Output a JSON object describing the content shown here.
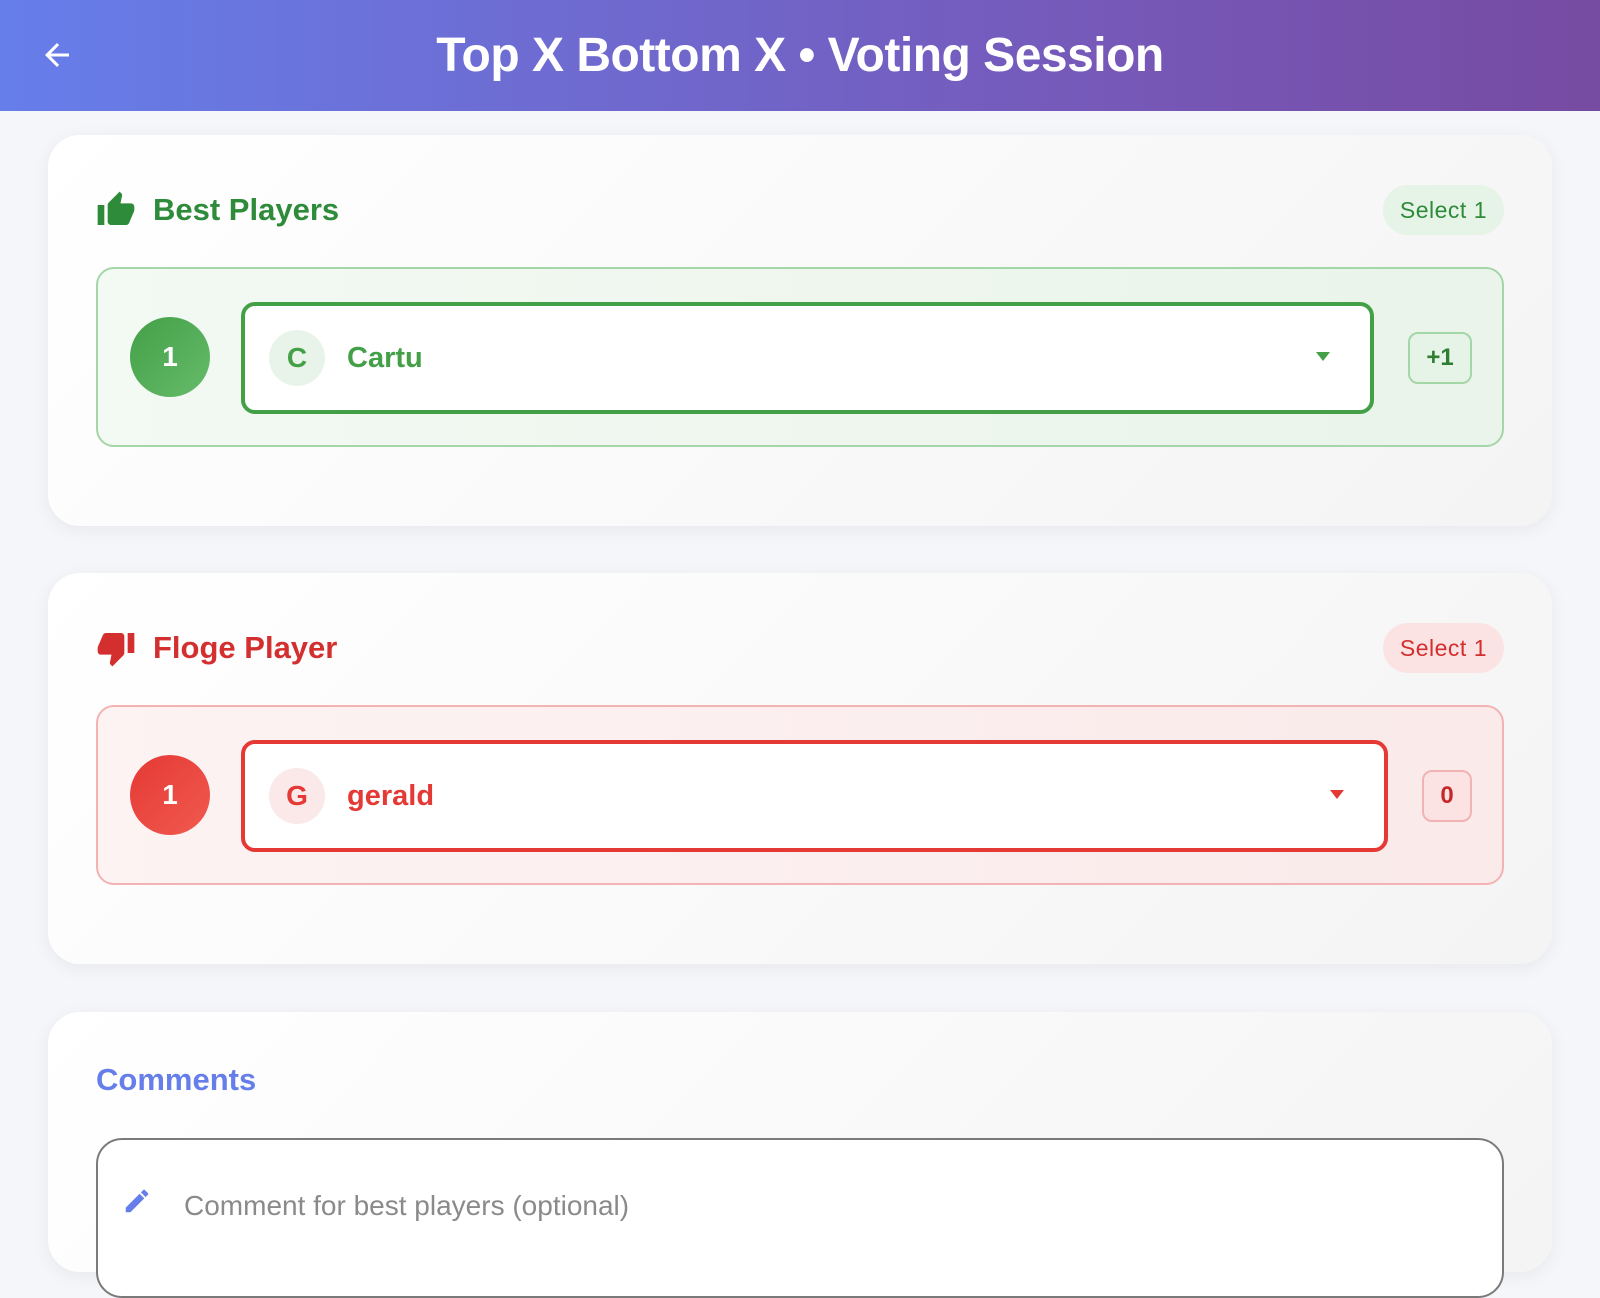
{
  "header": {
    "title": "Top X Bottom X • Voting Session",
    "back_icon": "arrow-left-icon"
  },
  "best_section": {
    "title": "Best Players",
    "icon": "thumbs-up-icon",
    "chip": "Select 1",
    "accent": "#43a047",
    "entries": [
      {
        "rank": "1",
        "avatar": "C",
        "name": "Cartu",
        "score": "+1"
      }
    ]
  },
  "floge_section": {
    "title": "Floge Player",
    "icon": "thumbs-down-icon",
    "chip": "Select 1",
    "accent": "#e53935",
    "entries": [
      {
        "rank": "1",
        "avatar": "G",
        "name": "gerald",
        "score": "0"
      }
    ]
  },
  "comments": {
    "title": "Comments",
    "placeholder": "Comment for best players (optional)",
    "icon": "pencil-icon"
  },
  "colors": {
    "header_gradient_start": "#667eea",
    "header_gradient_end": "#764ba2",
    "comments_accent": "#667eea"
  }
}
